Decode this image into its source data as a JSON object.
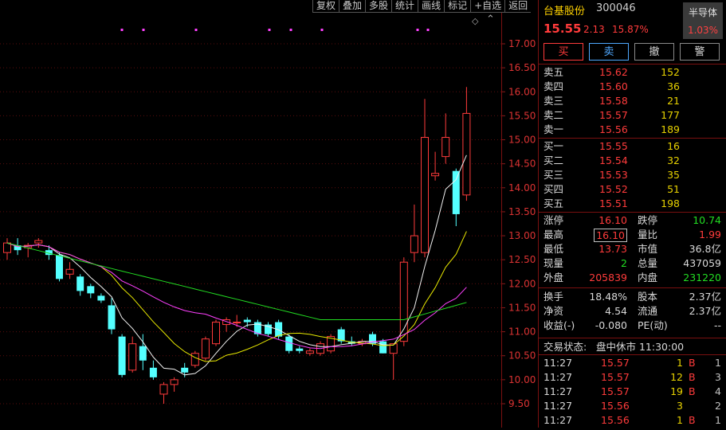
{
  "toolbar": [
    "复权",
    "叠加",
    "多股",
    "统计",
    "画线",
    "标记",
    "+自选",
    "返回"
  ],
  "chart": {
    "price_ticks": [
      "17.00",
      "16.50",
      "16.00",
      "15.50",
      "15.00",
      "14.50",
      "14.00",
      "13.50",
      "13.00",
      "12.50",
      "12.00",
      "11.50",
      "11.00",
      "10.50",
      "10.00",
      "9.50"
    ],
    "candles": [
      [
        12.65,
        12.95,
        12.5,
        12.85
      ],
      [
        12.8,
        12.95,
        12.6,
        12.7
      ],
      [
        12.75,
        12.85,
        12.55,
        12.8
      ],
      [
        12.85,
        12.95,
        12.75,
        12.9
      ],
      [
        12.7,
        12.8,
        12.5,
        12.6
      ],
      [
        12.6,
        12.65,
        12.05,
        12.1
      ],
      [
        12.2,
        12.45,
        12.1,
        12.3
      ],
      [
        12.15,
        12.2,
        11.75,
        11.85
      ],
      [
        11.95,
        12.0,
        11.7,
        11.8
      ],
      [
        11.75,
        11.8,
        11.6,
        11.65
      ],
      [
        11.55,
        11.7,
        10.95,
        11.05
      ],
      [
        10.9,
        10.95,
        10.05,
        10.1
      ],
      [
        10.2,
        10.9,
        10.15,
        10.75
      ],
      [
        10.7,
        10.95,
        10.2,
        10.4
      ],
      [
        10.25,
        10.4,
        10.0,
        10.05
      ],
      [
        9.7,
        9.95,
        9.5,
        9.9
      ],
      [
        9.9,
        10.05,
        9.75,
        10.0
      ],
      [
        10.25,
        10.35,
        10.05,
        10.15
      ],
      [
        10.3,
        10.6,
        10.25,
        10.55
      ],
      [
        10.45,
        10.9,
        10.4,
        10.85
      ],
      [
        10.75,
        11.25,
        10.7,
        11.2
      ],
      [
        11.15,
        11.3,
        11.0,
        11.25
      ],
      [
        11.2,
        11.35,
        11.1,
        11.2
      ],
      [
        11.25,
        11.3,
        11.1,
        11.2
      ],
      [
        11.2,
        11.25,
        10.9,
        10.95
      ],
      [
        11.15,
        11.2,
        10.9,
        10.95
      ],
      [
        11.2,
        11.25,
        10.85,
        10.9
      ],
      [
        10.9,
        10.95,
        10.55,
        10.6
      ],
      [
        10.65,
        10.7,
        10.55,
        10.6
      ],
      [
        10.55,
        10.65,
        10.5,
        10.6
      ],
      [
        10.55,
        10.8,
        10.5,
        10.75
      ],
      [
        10.6,
        10.95,
        10.55,
        10.9
      ],
      [
        11.05,
        11.1,
        10.75,
        10.8
      ],
      [
        10.8,
        10.9,
        10.7,
        10.75
      ],
      [
        10.75,
        10.85,
        10.7,
        10.8
      ],
      [
        10.95,
        11.0,
        10.7,
        10.75
      ],
      [
        10.8,
        10.85,
        10.55,
        10.55
      ],
      [
        10.55,
        10.6,
        10.0,
        10.75
      ],
      [
        10.8,
        12.55,
        10.7,
        12.45
      ],
      [
        12.65,
        13.65,
        12.45,
        13.0
      ],
      [
        12.65,
        15.85,
        12.55,
        15.05
      ],
      [
        14.25,
        14.75,
        14.15,
        14.3
      ],
      [
        14.65,
        15.55,
        14.5,
        15.05
      ],
      [
        14.35,
        14.4,
        13.2,
        13.45
      ],
      [
        13.85,
        16.1,
        13.73,
        15.55
      ]
    ]
  },
  "quote": {
    "name": "台基股份",
    "code": "300046",
    "sector": "半导体",
    "sector_pct": "1.03%",
    "last": "15.55",
    "change": "2.13",
    "change_pct": "15.87%"
  },
  "buttons": {
    "buy": "买",
    "sell": "卖",
    "cancel": "撤",
    "alert": "警"
  },
  "asks": [
    {
      "label": "卖五",
      "price": "15.62",
      "vol": "152"
    },
    {
      "label": "卖四",
      "price": "15.60",
      "vol": "36"
    },
    {
      "label": "卖三",
      "price": "15.58",
      "vol": "21"
    },
    {
      "label": "卖二",
      "price": "15.57",
      "vol": "177"
    },
    {
      "label": "卖一",
      "price": "15.56",
      "vol": "189"
    }
  ],
  "bids": [
    {
      "label": "买一",
      "price": "15.55",
      "vol": "16"
    },
    {
      "label": "买二",
      "price": "15.54",
      "vol": "32"
    },
    {
      "label": "买三",
      "price": "15.53",
      "vol": "35"
    },
    {
      "label": "买四",
      "price": "15.52",
      "vol": "51"
    },
    {
      "label": "买五",
      "price": "15.51",
      "vol": "198"
    }
  ],
  "stats": [
    {
      "l1": "涨停",
      "v1": "16.10",
      "l2": "跌停",
      "v2": "10.74"
    },
    {
      "l1": "最高",
      "v1": "16.10",
      "l2": "量比",
      "v2": "1.99"
    },
    {
      "l1": "最低",
      "v1": "13.73",
      "l2": "市值",
      "v2": "36.8亿"
    },
    {
      "l1": "现量",
      "v1": "2",
      "l2": "总量",
      "v2": "437059"
    },
    {
      "l1": "外盘",
      "v1": "205839",
      "l2": "内盘",
      "v2": "231220"
    }
  ],
  "fund": [
    {
      "l1": "换手",
      "v1": "18.48%",
      "l2": "股本",
      "v2": "2.37亿"
    },
    {
      "l1": "净资",
      "v1": "4.54",
      "l2": "流通",
      "v2": "2.37亿"
    },
    {
      "l1": "收益(-)",
      "v1": "-0.080",
      "l2": "PE(动)",
      "v2": "--"
    }
  ],
  "status": {
    "label": "交易状态:",
    "value": "盘中休市 11:30:00"
  },
  "ticks": [
    {
      "time": "11:27",
      "price": "15.57",
      "vol": "1",
      "side": "B",
      "n": "1"
    },
    {
      "time": "11:27",
      "price": "15.57",
      "vol": "12",
      "side": "B",
      "n": "3"
    },
    {
      "time": "11:27",
      "price": "15.57",
      "vol": "19",
      "side": "B",
      "n": "4"
    },
    {
      "time": "11:27",
      "price": "15.56",
      "vol": "3",
      "side": "",
      "n": "2"
    },
    {
      "time": "11:27",
      "price": "15.56",
      "vol": "1",
      "side": "B",
      "n": "1"
    }
  ]
}
